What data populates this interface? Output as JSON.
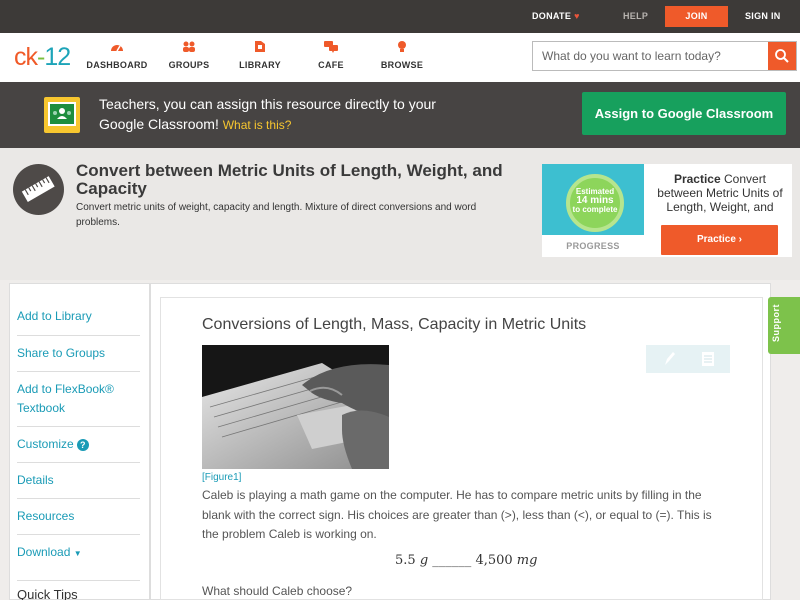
{
  "topbar": {
    "donate": "DONATE",
    "help": "HELP",
    "join": "JOIN",
    "signin": "SIGN IN"
  },
  "header": {
    "logo": {
      "left": "ck",
      "dash": "-",
      "right": "12"
    },
    "nav": [
      {
        "label": "DASHBOARD",
        "icon": "dashboard-icon"
      },
      {
        "label": "GROUPS",
        "icon": "groups-icon"
      },
      {
        "label": "LIBRARY",
        "icon": "library-icon"
      },
      {
        "label": "CAFE",
        "icon": "cafe-icon"
      },
      {
        "label": "BROWSE",
        "icon": "browse-icon"
      }
    ],
    "search_placeholder": "What do you want to learn today?"
  },
  "banner": {
    "text": "Teachers, you can assign this resource directly to your Google Classroom!",
    "what": "What is this?",
    "button": "Assign to Google Classroom"
  },
  "lesson": {
    "title": "Convert between Metric Units of Length, Weight, and Capacity",
    "description": "Convert metric units of weight, capacity and length. Mixture of direct conversions and word problems."
  },
  "practice": {
    "estimated": "Estimated",
    "mins": "14 mins",
    "to_complete": "to complete",
    "progress_label": "PROGRESS",
    "heading_bold": "Practice",
    "heading_rest": "Convert between Metric Units of Length, Weight, and",
    "button": "Practice"
  },
  "sidebar": {
    "items": [
      {
        "label": "Add to Library"
      },
      {
        "label": "Share to Groups"
      },
      {
        "label": "Add to FlexBook® Textbook"
      },
      {
        "label": "Customize"
      },
      {
        "label": "Details"
      },
      {
        "label": "Resources"
      },
      {
        "label": "Download"
      }
    ],
    "quick_tips": "Quick Tips"
  },
  "content": {
    "title": "Conversions of Length, Mass, Capacity in Metric Units",
    "figure_caption": "[Figure1]",
    "paragraph": "Caleb is playing a math game on the computer. He has to compare metric units by filling in the blank with the correct sign. His choices are greater than (>), less than (<), or equal to (=). This is the problem Caleb is working on.",
    "math_left": "5.5",
    "math_left_unit": "g",
    "math_blank": "______",
    "math_right": "4,500",
    "math_right_unit": "mg",
    "question": "What should Caleb choose?"
  },
  "support": "Support",
  "colors": {
    "accent_orange": "#ef5a2a",
    "link_teal": "#1a9bb6",
    "google_green": "#17a05d",
    "support_green": "#7dc24b"
  }
}
